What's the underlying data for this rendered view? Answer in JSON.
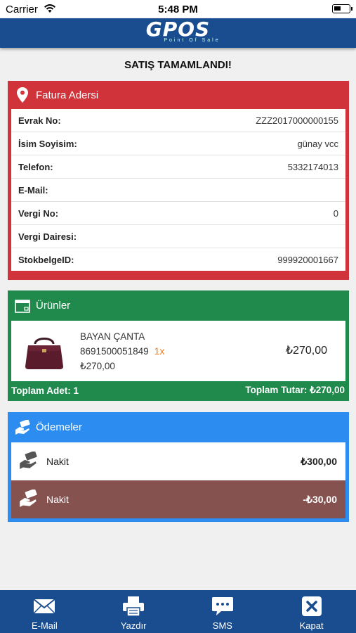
{
  "status_bar": {
    "carrier": "Carrier",
    "time": "5:48 PM"
  },
  "header": {
    "logo": "GPOS",
    "logo_sub": "Point Of Sale"
  },
  "page_title": "SATIŞ TAMAMLANDI!",
  "invoice": {
    "title": "Fatura Adersi",
    "rows": [
      {
        "label": "Evrak No:",
        "value": "ZZZ2017000000155"
      },
      {
        "label": "İsim Soyisim:",
        "value": "günay vcc"
      },
      {
        "label": "Telefon:",
        "value": "5332174013"
      },
      {
        "label": "E-Mail:",
        "value": ""
      },
      {
        "label": "Vergi No:",
        "value": "0"
      },
      {
        "label": "Vergi Dairesi:",
        "value": ""
      },
      {
        "label": "StokbelgeID:",
        "value": "999920001667"
      }
    ]
  },
  "products": {
    "title": "Ürünler",
    "items": [
      {
        "name": "BAYAN ÇANTA",
        "barcode": "8691500051849",
        "qty": "1x",
        "unit_price": "₺270,00",
        "total": "₺270,00"
      }
    ],
    "total_qty": "Toplam Adet: 1",
    "total_amount": "Toplam Tutar: ₺270,00"
  },
  "payments": {
    "title": "Ödemeler",
    "items": [
      {
        "label": "Nakit",
        "amount": "₺300,00"
      },
      {
        "label": "Nakit",
        "amount": "-₺30,00"
      }
    ]
  },
  "tabbar": {
    "email": "E-Mail",
    "print": "Yazdır",
    "sms": "SMS",
    "close": "Kapat"
  },
  "colors": {
    "navy": "#1a4d8f",
    "red": "#d0343a",
    "green": "#1f8a4c",
    "blue": "#2d8cf0",
    "change_row": "#85524f",
    "qty_orange": "#f07b1a"
  }
}
